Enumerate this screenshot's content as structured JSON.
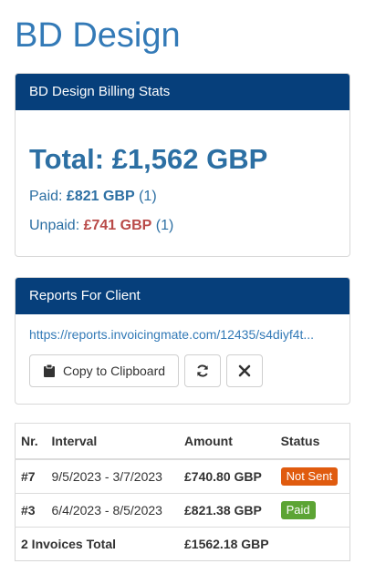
{
  "client": {
    "name": "BD Design"
  },
  "stats": {
    "heading": "BD Design Billing Stats",
    "total_label": "Total:",
    "total_value": "£1,562 GBP",
    "paid_label": "Paid:",
    "paid_value": "£821 GBP",
    "paid_count": "(1)",
    "unpaid_label": "Unpaid:",
    "unpaid_value": "£741 GBP",
    "unpaid_count": "(1)"
  },
  "reports": {
    "heading": "Reports For Client",
    "link": "https://reports.invoicingmate.com/12435/s4diyf4t...",
    "copy_label": "Copy to Clipboard"
  },
  "invoices": {
    "headers": {
      "nr": "Nr.",
      "interval": "Interval",
      "amount": "Amount",
      "status": "Status"
    },
    "rows": [
      {
        "nr": "#7",
        "interval": "9/5/2023 - 3/7/2023",
        "amount": "£740.80 GBP",
        "status": "Not Sent"
      },
      {
        "nr": "#3",
        "interval": "6/4/2023 - 8/5/2023",
        "amount": "£821.38 GBP",
        "status": "Paid"
      }
    ],
    "total_label": "2 Invoices Total",
    "total_amount": "£1562.18 GBP"
  },
  "colors": {
    "title": "#337ab7",
    "panel_heading": "#063f7b",
    "unpaid": "#b94a48",
    "status_not_sent": "#e05b0f",
    "status_paid": "#5ca434"
  },
  "icons": [
    "clipboard-icon",
    "refresh-icon",
    "close-icon"
  ]
}
